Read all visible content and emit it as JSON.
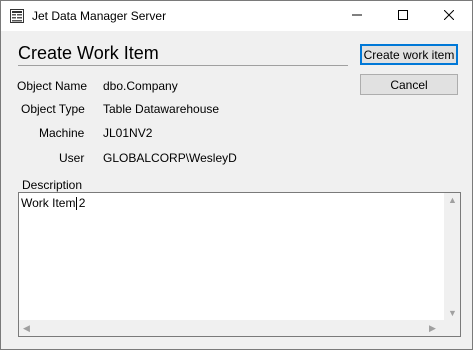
{
  "window": {
    "title": "Jet Data Manager Server"
  },
  "titlebar": {
    "icon": "app-icon",
    "minimize_icon": "minimize-icon",
    "maximize_icon": "maximize-icon",
    "close_icon": "close-icon"
  },
  "form": {
    "heading": "Create Work Item",
    "fields": [
      {
        "label": "Object Name",
        "value": "dbo.Company"
      },
      {
        "label": "Object Type",
        "value": "Table Datawarehouse"
      },
      {
        "label": "Machine",
        "value": "JL01NV2"
      },
      {
        "label": "User",
        "value": "GLOBALCORP\\WesleyD"
      }
    ],
    "description_label": "Description",
    "description_value": "Work Item 2"
  },
  "buttons": {
    "create_label": "Create work item",
    "cancel_label": "Cancel"
  },
  "colors": {
    "accent": "#0078d7",
    "window_bg": "#f0f0f0",
    "titlebar_bg": "#ffffff"
  }
}
